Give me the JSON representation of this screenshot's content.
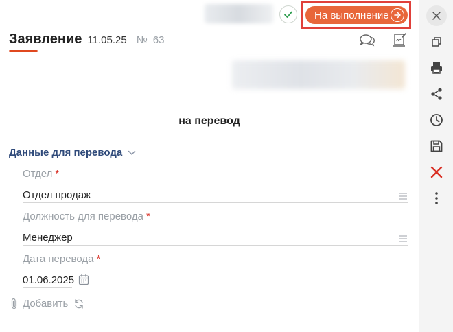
{
  "toolbar": {
    "execute_label": "На выполнение"
  },
  "document": {
    "title": "Заявление",
    "date": "11.05.25",
    "number_sign": "№",
    "number": "63",
    "subtitle": "на перевод"
  },
  "section": {
    "title": "Данные для перевода"
  },
  "fields": [
    {
      "label": "Отдел",
      "required_mark": "*",
      "value": "Отдел продаж"
    },
    {
      "label": "Должность для перевода",
      "required_mark": "*",
      "value": "Менеджер"
    },
    {
      "label": "Дата перевода",
      "required_mark": "*",
      "value": "01.06.2025"
    }
  ],
  "attachments": {
    "add_label": "Добавить"
  },
  "colors": {
    "accent": "#e8663a",
    "highlight_frame": "#e0403a",
    "section_title": "#2f4a7a",
    "required": "#d93025",
    "delete": "#d93025"
  },
  "icons": {
    "rail": [
      "close-icon",
      "copy-icon",
      "print-icon",
      "share-icon",
      "history-icon",
      "save-icon",
      "delete-icon",
      "more-icon"
    ],
    "header": [
      "check-icon",
      "arrow-right-icon",
      "comment-icon",
      "sign-document-icon"
    ],
    "fields": [
      "list-menu-icon",
      "calendar-icon",
      "paperclip-icon",
      "refresh-icon",
      "chevron-down-icon"
    ]
  }
}
